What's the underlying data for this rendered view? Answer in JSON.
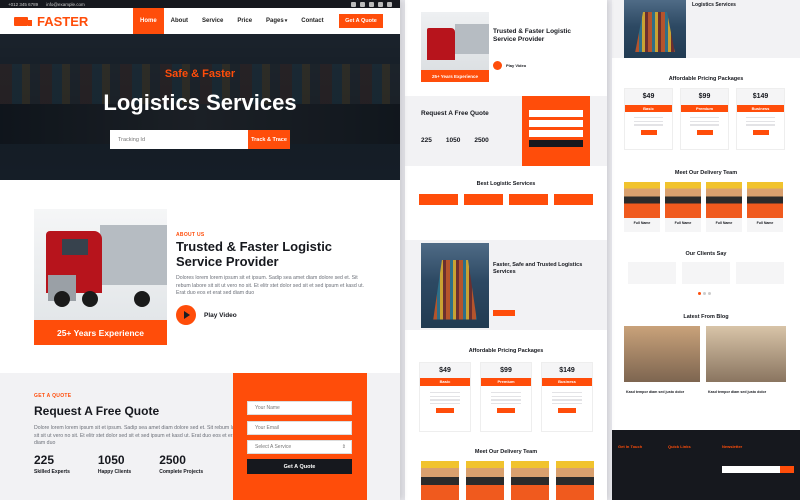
{
  "topbar": {
    "phone": "+012 345 6789",
    "email": "info@example.com"
  },
  "brand": {
    "name": "FASTER"
  },
  "nav": {
    "items": [
      "Home",
      "About",
      "Service",
      "Price",
      "Pages",
      "Contact"
    ],
    "cta": "Get A Quote",
    "pages_caret": "▾"
  },
  "hero": {
    "subtitle": "Safe & Faster",
    "title": "Logistics Services",
    "tracking_placeholder": "Tracking Id",
    "track_button": "Track & Trace"
  },
  "about": {
    "tag": "ABOUT US",
    "title": "Trusted & Faster Logistic Service Provider",
    "text": "Dolores lorem lorem ipsum sit et ipsum. Sadip sea amet diam dolore sed et. Sit rebum labore sit sit ut vero no sit. Et elitr stet dolor sed sit et sed ipsum et kasd ut. Erat duo eos et erat sed diam duo",
    "experience": "25+ Years Experience",
    "play": "Play Video"
  },
  "quote": {
    "tag": "GET A QUOTE",
    "title": "Request A Free Quote",
    "text": "Dolore lorem lorem ipsum sit et ipsum. Sadip sea amet diam dolore sed et. Sit rebum labore sit sit ut vero no sit. Et elitr stet dolor sed sit et sed ipsum et kasd ut. Erat duo eos et erat sed diam duo",
    "stats": [
      {
        "num": "225",
        "label": "Skilled Experts"
      },
      {
        "num": "1050",
        "label": "Happy Clients"
      },
      {
        "num": "2500",
        "label": "Complete Projects"
      }
    ],
    "form": {
      "name": "Your Name",
      "email": "Your Email",
      "select": "Select A Service",
      "submit": "Get A Quote"
    }
  },
  "middle": {
    "about_title": "Trusted & Faster Logistic Service Provider",
    "experience": "25+ Years Experience",
    "play": "Play Video",
    "quote_title": "Request A Free Quote",
    "stats": [
      "225",
      "1050",
      "2500"
    ],
    "services_title": "Best Logistic Services",
    "feature_title": "Faster, Safe and Trusted Logistics Services",
    "pricing_title": "Affordable Pricing Packages",
    "plans": [
      {
        "price": "$49",
        "name": "Basic"
      },
      {
        "price": "$99",
        "name": "Premium"
      },
      {
        "price": "$149",
        "name": "Business"
      }
    ],
    "team_title": "Meet Our Delivery Team"
  },
  "right": {
    "feature_title": "Logistics Services",
    "pricing_title": "Affordable Pricing Packages",
    "plans": [
      {
        "price": "$49",
        "name": "Basic"
      },
      {
        "price": "$99",
        "name": "Premium"
      },
      {
        "price": "$149",
        "name": "Business"
      }
    ],
    "team_title": "Meet Our Delivery Team",
    "member_name": "Full Name",
    "clients_title": "Our Clients Say",
    "blog_title": "Latest From Blog",
    "blog_post": "Kasd tempor diam sed justo dolor",
    "footer_cols": [
      "Get In Touch",
      "Quick Links",
      "Newsletter"
    ]
  }
}
